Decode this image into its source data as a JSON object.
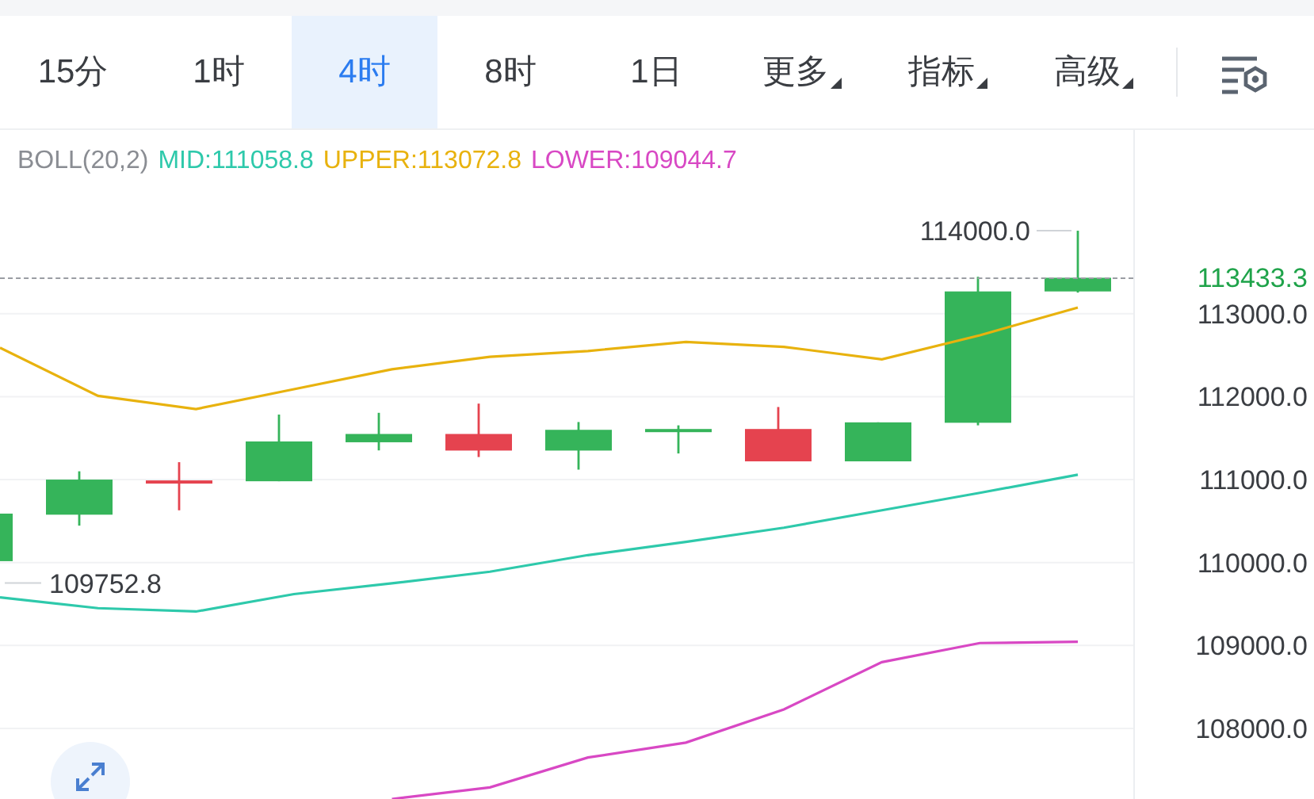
{
  "tabs": [
    {
      "label": "15分",
      "selected": false,
      "dropdown": false
    },
    {
      "label": "1时",
      "selected": false,
      "dropdown": false
    },
    {
      "label": "4时",
      "selected": true,
      "dropdown": false
    },
    {
      "label": "8时",
      "selected": false,
      "dropdown": false
    },
    {
      "label": "1日",
      "selected": false,
      "dropdown": false
    },
    {
      "label": "更多",
      "selected": false,
      "dropdown": true
    },
    {
      "label": "指标",
      "selected": false,
      "dropdown": true
    },
    {
      "label": "高级",
      "selected": false,
      "dropdown": true
    }
  ],
  "indicator": "BOLL(20,2)",
  "high_price": "114000.0",
  "low_price": "109752.8",
  "last_price": "113433.3",
  "chart_data": {
    "type": "line",
    "grid": true,
    "ylim": [
      107150,
      115214
    ],
    "yticks": [
      {
        "value": 113000,
        "label": "113000.0"
      },
      {
        "value": 112000,
        "label": "112000.0"
      },
      {
        "value": 111000,
        "label": "111000.0"
      },
      {
        "value": 110000,
        "label": "110000.0"
      },
      {
        "value": 109000,
        "label": "109000.0"
      },
      {
        "value": 108000,
        "label": "108000.0"
      }
    ],
    "series": [
      {
        "name": "MID:111058.8",
        "color": "#2ec9ab",
        "values": [
          109580,
          109450,
          109410,
          109620,
          109750,
          109890,
          110090,
          110250,
          110420,
          110630,
          110840,
          111059
        ]
      },
      {
        "name": "UPPER:113072.8",
        "color": "#e8b20e",
        "values": [
          112590,
          112010,
          111850,
          112090,
          112330,
          112480,
          112550,
          112660,
          112600,
          112450,
          112740,
          113073
        ]
      },
      {
        "name": "LOWER:109044.7",
        "color": "#d848c4",
        "values": [
          null,
          null,
          null,
          null,
          107150,
          107290,
          107650,
          107830,
          108230,
          108800,
          109030,
          109045
        ]
      }
    ]
  }
}
